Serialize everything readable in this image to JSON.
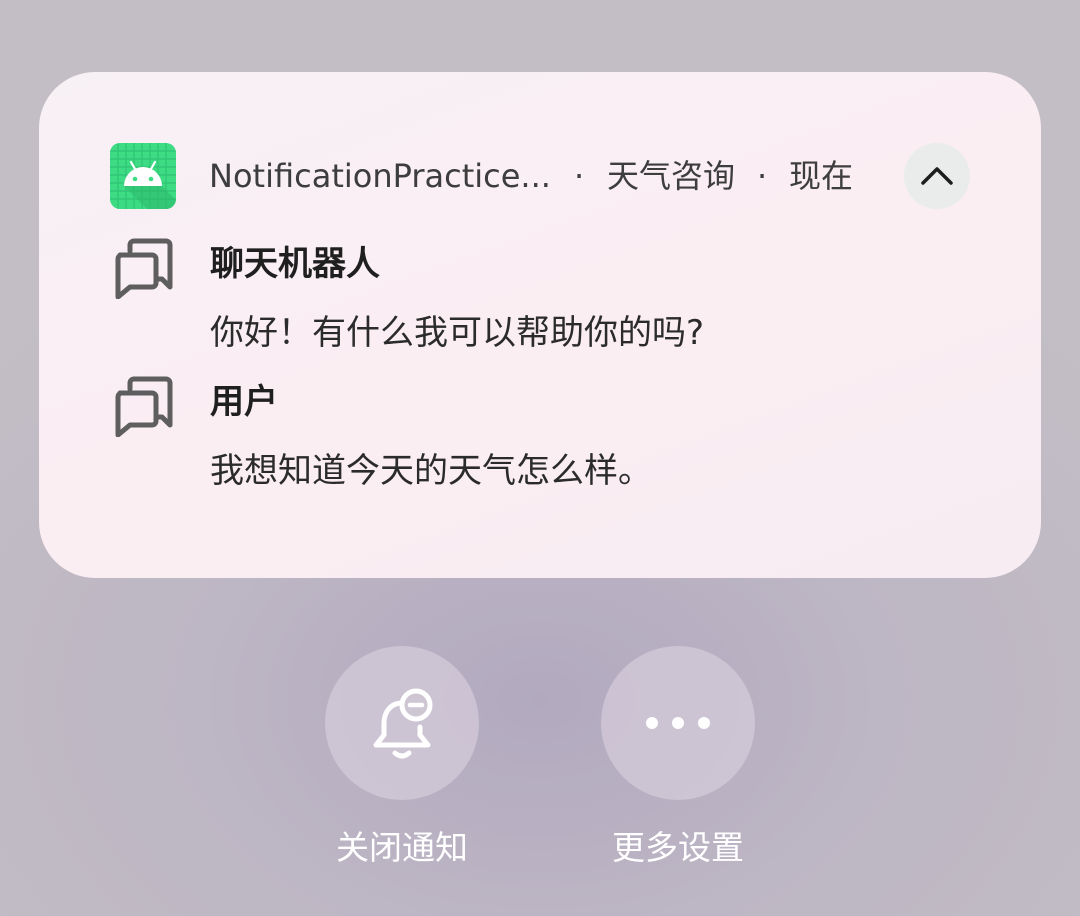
{
  "notification": {
    "app_name": "NotificationPractice...",
    "separator": "·",
    "channel": "天气咨询",
    "time": "现在",
    "app_icon": "android-icon",
    "collapse_icon": "chevron-up-icon",
    "messages": [
      {
        "sender": "聊天机器人",
        "text": "你好！有什么我可以帮助你的吗?",
        "icon": "chat-bubbles-icon"
      },
      {
        "sender": "用户",
        "text": "我想知道今天的天气怎么样。",
        "icon": "chat-bubbles-icon"
      }
    ]
  },
  "actions": [
    {
      "label": "关闭通知",
      "icon": "bell-off-icon"
    },
    {
      "label": "更多设置",
      "icon": "more-icon"
    }
  ],
  "colors": {
    "app_icon_green": "#3ddc84",
    "card_background": "#f8eef3",
    "action_label": "#ffffff"
  }
}
